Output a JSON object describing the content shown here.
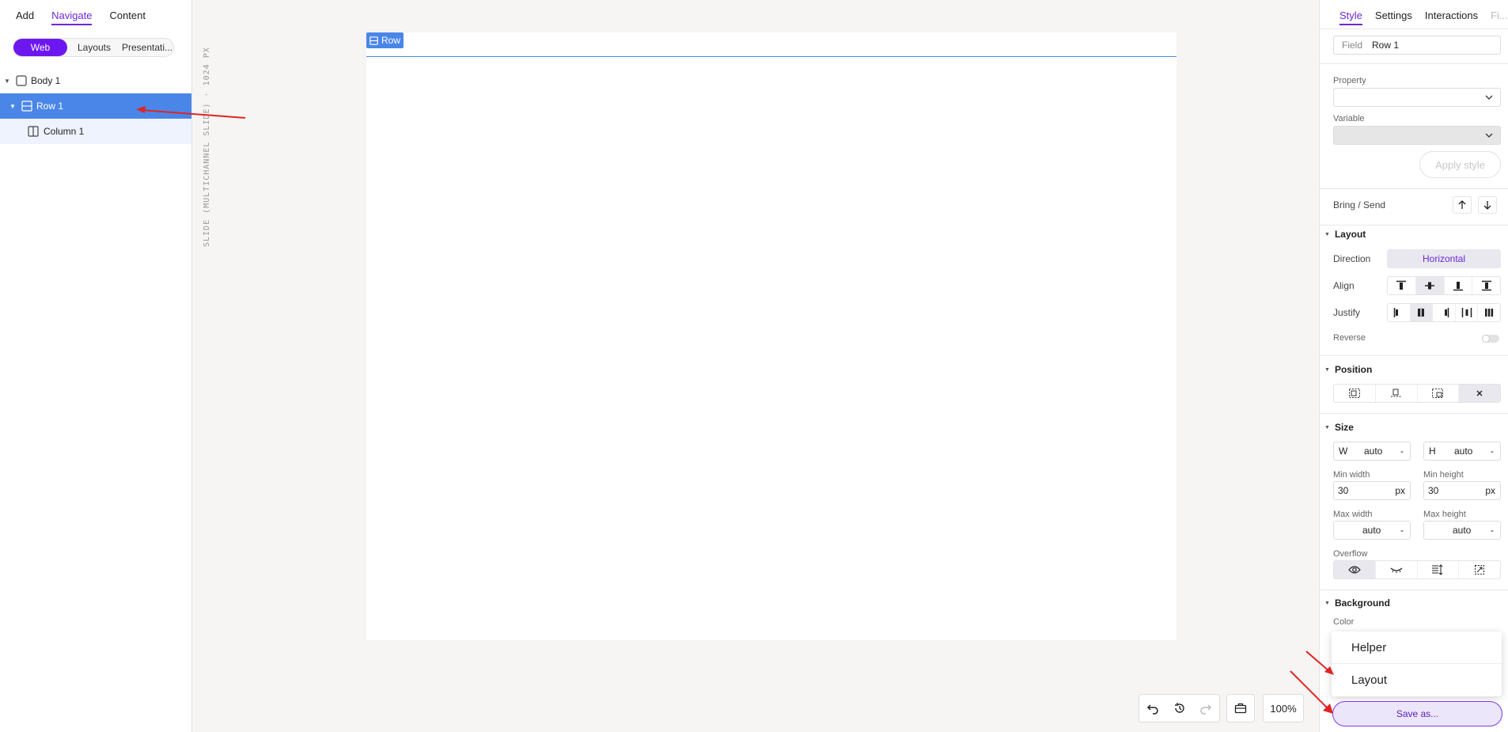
{
  "left_panel": {
    "tabs": [
      "Add",
      "Navigate",
      "Content"
    ],
    "active_tab": "Navigate",
    "segments": [
      "Web",
      "Layouts",
      "Presentati..."
    ],
    "tree": [
      {
        "label": "Body 1",
        "icon": "checkbox-square-icon"
      },
      {
        "label": "Row 1",
        "icon": "row-layout-icon"
      },
      {
        "label": "Column 1",
        "icon": "column-layout-icon"
      }
    ]
  },
  "canvas": {
    "vertical_label": "SLIDE (MULTICHANNEL SLIDE) · 1024 PX",
    "row_tag": "Row"
  },
  "toolbar": {
    "zoom": "100%",
    "icons": [
      "undo-icon",
      "history-icon",
      "redo-icon",
      "briefcase-icon"
    ]
  },
  "right_panel": {
    "tabs": [
      "Style",
      "Settings",
      "Interactions",
      "Fi..."
    ],
    "field_label": "Field",
    "field_value": "Row 1",
    "property_label": "Property",
    "property_value": "",
    "variable_label": "Variable",
    "variable_value": "",
    "apply_style": "Apply style",
    "bring_send": "Bring / Send",
    "layout": {
      "title": "Layout",
      "direction_label": "Direction",
      "direction_value": "Horizontal",
      "align_label": "Align",
      "justify_label": "Justify",
      "reverse_label": "Reverse"
    },
    "position": {
      "title": "Position"
    },
    "size": {
      "title": "Size",
      "w_label": "W",
      "w_value": "auto",
      "h_label": "H",
      "h_value": "auto",
      "dash": "-",
      "min_width_label": "Min width",
      "min_width_value": "30",
      "min_width_unit": "px",
      "min_height_label": "Min height",
      "min_height_value": "30",
      "min_height_unit": "px",
      "max_width_label": "Max width",
      "max_width_value": "auto",
      "max_height_label": "Max height",
      "max_height_value": "auto",
      "overflow_label": "Overflow"
    },
    "background": {
      "title": "Background",
      "color_label": "Color"
    }
  },
  "popup_menu": {
    "items": [
      "Helper",
      "Layout"
    ]
  },
  "save_as": "Save as...",
  "colors": {
    "accent": "#6d28d9",
    "selection": "#4a86e8",
    "arrow": "#e02424"
  }
}
